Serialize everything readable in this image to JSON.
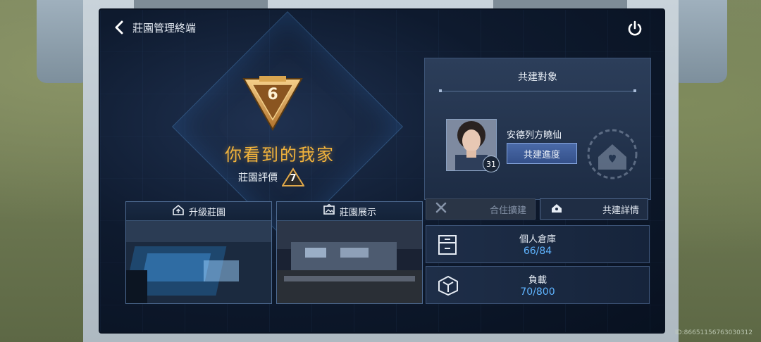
{
  "header": {
    "title": "莊園管理終端"
  },
  "estate": {
    "level": "6",
    "name": "你看到的我家",
    "rating_label": "莊園評價",
    "rating_value": "7"
  },
  "cards": [
    {
      "label": "升級莊園",
      "icon": "house-upgrade-icon"
    },
    {
      "label": "莊園展示",
      "icon": "picture-frame-icon"
    }
  ],
  "coop": {
    "title": "共建對象",
    "partner_name": "安德列方曉仙",
    "partner_level": "31",
    "progress_button": "共建進度",
    "cohabit_button": "合住擴建",
    "details_button": "共建詳情"
  },
  "stats": {
    "storage_label": "個人倉庫",
    "storage_value": "66/84",
    "load_label": "負載",
    "load_value": "70/800"
  },
  "footer": {
    "id_text": "ID:86651156763030312"
  },
  "colors": {
    "accent_gold": "#f0b23c",
    "accent_blue": "#5fb4ff",
    "panel_bg": "#1d2c44"
  }
}
